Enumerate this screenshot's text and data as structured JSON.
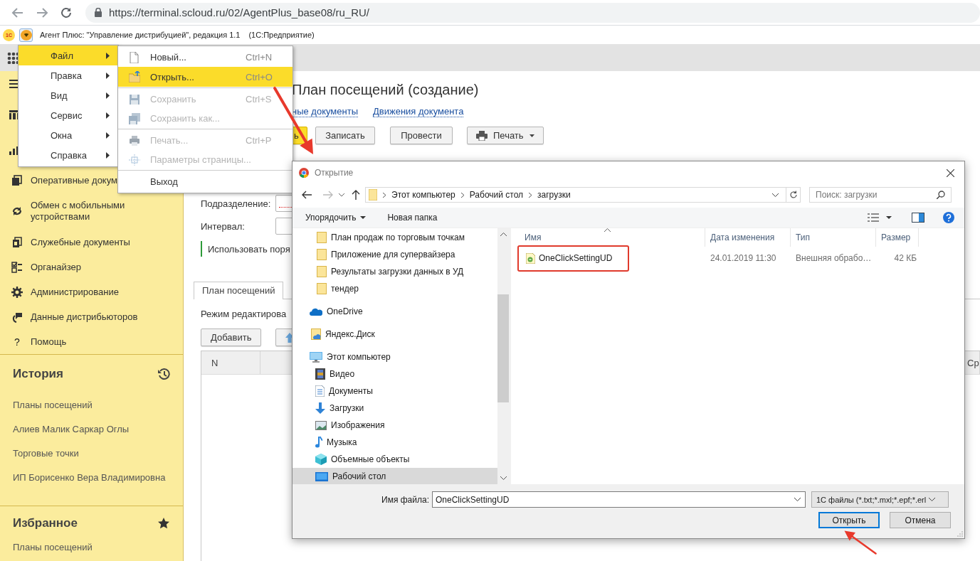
{
  "browser": {
    "url": "https://terminal.scloud.ru/02/AgentPlus_base08/ru_RU/"
  },
  "app_header": {
    "logo": "1С",
    "title": "Агент Плюс: \"Управление дистрибуцией\", редакция 1.1",
    "platform": "(1С:Предприятие)",
    "menu_open": true
  },
  "sidebar": {
    "nav": [
      {
        "kind": "toggle"
      },
      {
        "kind": "icon"
      },
      {
        "kind": "icon"
      },
      {
        "kind": "item",
        "label": "Оперативные докум"
      },
      {
        "kind": "item",
        "label": "Обмен с мобильными устройствами"
      },
      {
        "kind": "item",
        "label": "Служебные документы"
      },
      {
        "kind": "item",
        "label": "Органайзер"
      },
      {
        "kind": "item",
        "label": "Администрирование"
      },
      {
        "kind": "item",
        "label": "Данные дистрибьюторов"
      },
      {
        "kind": "help",
        "label": "Помощь",
        "mark": "?"
      }
    ],
    "history": {
      "title": "История",
      "items": [
        "Планы посещений",
        "Алиев Малик Саркар Оглы",
        "Торговые точки",
        "ИП Борисенко Вера Владимировна"
      ]
    },
    "favorites": {
      "title": "Избранное",
      "items": [
        "Планы посещений"
      ]
    }
  },
  "document": {
    "title": "План посещений (создание)",
    "links": [
      "ные документы",
      "Движения документа"
    ],
    "buttons": [
      {
        "kind": "primary",
        "label": "ь"
      },
      {
        "kind": "plain",
        "label": "Записать"
      },
      {
        "kind": "plain",
        "label": "Провести"
      },
      {
        "kind": "print",
        "label": "Печать"
      }
    ],
    "fields": [
      {
        "label": "Подразделение:",
        "required": true
      },
      {
        "label": "Интервал:",
        "required": false
      }
    ],
    "checkbox_label": "Использовать поря",
    "tabs": [
      {
        "label": "План посещений",
        "selected": true
      }
    ],
    "mode_label": "Режим редактирова",
    "table_buttons": [
      {
        "kind": "text",
        "label": "Добавить"
      },
      {
        "kind": "up"
      }
    ],
    "table": {
      "columns": [
        {
          "kind": "label",
          "label": "N"
        },
        {
          "kind": "empty"
        },
        {
          "kind": "label",
          "label": "Ср"
        }
      ]
    }
  },
  "main_menu": {
    "items": [
      {
        "label": "Файл",
        "selected": true
      },
      {
        "label": "Правка",
        "selected": false
      },
      {
        "label": "Вид",
        "selected": false
      },
      {
        "label": "Сервис",
        "selected": false
      },
      {
        "label": "Окна",
        "selected": false
      },
      {
        "label": "Справка",
        "selected": false
      }
    ],
    "submenu": [
      {
        "kind": "item",
        "label": "Новый...",
        "shortcut": "Ctrl+N",
        "disabled": false,
        "selected": false
      },
      {
        "kind": "item",
        "label": "Открыть...",
        "shortcut": "Ctrl+O",
        "disabled": false,
        "selected": true
      },
      {
        "kind": "separator"
      },
      {
        "kind": "item",
        "label": "Сохранить",
        "shortcut": "Ctrl+S",
        "disabled": true,
        "selected": false
      },
      {
        "kind": "item",
        "label": "Сохранить как...",
        "disabled": true,
        "selected": false
      },
      {
        "kind": "separator"
      },
      {
        "kind": "item",
        "label": "Печать...",
        "shortcut": "Ctrl+P",
        "disabled": true,
        "selected": false
      },
      {
        "kind": "item",
        "label": "Параметры страницы...",
        "disabled": true,
        "selected": false
      },
      {
        "kind": "separator"
      },
      {
        "kind": "item",
        "label": "Выход",
        "disabled": false,
        "selected": false
      }
    ]
  },
  "open_dialog": {
    "title": "Открытие",
    "path": [
      "Этот компьютер",
      "Рабочий стол",
      "загрузки"
    ],
    "search_placeholder": "Поиск: загрузки",
    "toolbar": [
      {
        "kind": "menu",
        "label": "Упорядочить"
      },
      {
        "kind": "plain",
        "label": "Новая папка"
      }
    ],
    "nav_tree": [
      {
        "kind": "folder",
        "label": "План продаж по торговым точкам",
        "selected": false
      },
      {
        "kind": "folder",
        "label": "Приложение для супервайзера",
        "selected": false
      },
      {
        "kind": "folder",
        "label": "Результаты загрузки данных в УД",
        "selected": false
      },
      {
        "kind": "folder",
        "label": "тендер",
        "selected": false
      },
      {
        "kind": "cloud",
        "label": "OneDrive",
        "selected": false
      },
      {
        "kind": "disk",
        "label": "Яндекс.Диск",
        "selected": false
      },
      {
        "kind": "pc",
        "label": "Этот компьютер",
        "selected": false,
        "children": [
          {
            "kind": "video",
            "label": "Видео",
            "selected": false
          },
          {
            "kind": "docs",
            "label": "Документы",
            "selected": false
          },
          {
            "kind": "download",
            "label": "Загрузки",
            "selected": false
          },
          {
            "kind": "images",
            "label": "Изображения",
            "selected": false
          },
          {
            "kind": "music",
            "label": "Музыка",
            "selected": false
          },
          {
            "kind": "cube",
            "label": "Объемные объекты",
            "selected": false
          },
          {
            "kind": "desktop",
            "label": "Рабочий стол",
            "selected": true
          }
        ]
      }
    ],
    "columns": [
      {
        "label": "Имя",
        "sorted": true
      },
      {
        "label": "Дата изменения",
        "sorted": false
      },
      {
        "label": "Тип",
        "sorted": false
      },
      {
        "label": "Размер",
        "sorted": false
      }
    ],
    "files": [
      {
        "name": "OneClickSettingUD",
        "date": "24.01.2019 11:30",
        "type": "Внешняя обрабо…",
        "size": "42 КБ",
        "annotated": true
      }
    ],
    "filename_label": "Имя файла:",
    "filename": "OneClickSettingUD",
    "filter": "1С файлы (*.txt;*.mxl;*.epf;*.erl",
    "buttons": [
      {
        "label": "Открыть",
        "default": true
      },
      {
        "label": "Отмена",
        "default": false
      }
    ]
  }
}
